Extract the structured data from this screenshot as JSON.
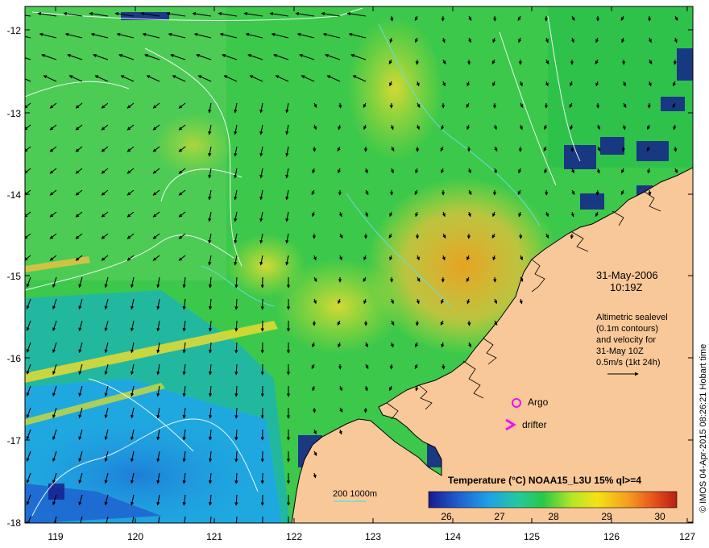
{
  "map": {
    "date": "31-May-2006",
    "time": "10:19Z",
    "altimetry_note": [
      "Altimetric sealevel",
      "(0.1m contours)",
      "and velocity for",
      "31-May 10Z",
      "0.5m/s (1kt 24h)"
    ],
    "legend_argo": "Argo",
    "legend_drifter": "drifter",
    "colorbar_title": "Temperature (°C) NOAA15_L3U 15% ql>=4",
    "colorbar_ticks": [
      "26",
      "27",
      "28",
      "29",
      "30"
    ],
    "bathymetry_label": "200  1000m",
    "credit": "© IMOS 04-Apr-2015 08:26:21 Hobart time",
    "lon_labels": [
      "119",
      "120",
      "121",
      "122",
      "123",
      "124",
      "125",
      "126",
      "127"
    ],
    "lat_labels": [
      "-12",
      "-13",
      "-14",
      "-15",
      "-16",
      "-17",
      "-18"
    ],
    "colors": {
      "land": "#f9c898",
      "argo": "#ee11ee",
      "drifter": "#ee11ee",
      "bathy_line": "#66dddd",
      "colorbar": [
        "#1a1a8c",
        "#1f5fd0",
        "#1fa0e6",
        "#25c8a0",
        "#28c848",
        "#b6e628",
        "#f5e214",
        "#f4a020",
        "#e8581c",
        "#b81e14"
      ]
    }
  }
}
